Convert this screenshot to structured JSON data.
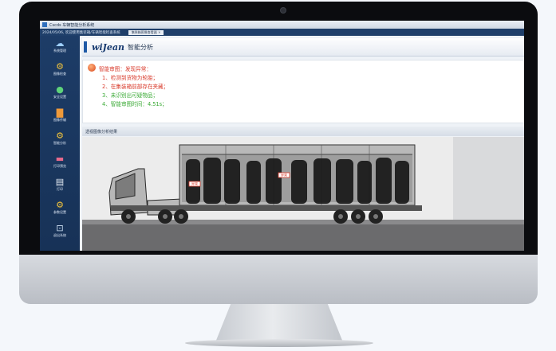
{
  "window": {
    "title": "Cscds 车辆智能分析系统",
    "info_text": "2024/05/06, 欢迎使用集装箱/车辆智能检查系统",
    "tab_label": "集装箱图像查看器"
  },
  "sidebar": {
    "items": [
      {
        "label": "系统管理",
        "icon": "cloud-icon"
      },
      {
        "label": "图像检查",
        "icon": "gear-icon"
      },
      {
        "label": "安全设置",
        "icon": "globe-icon"
      },
      {
        "label": "图像传输",
        "icon": "chart-icon"
      },
      {
        "label": "智能分析",
        "icon": "gear-icon"
      },
      {
        "label": "打印预览",
        "icon": "document-icon"
      },
      {
        "label": "打印",
        "icon": "printer-icon"
      },
      {
        "label": "参数设置",
        "icon": "gear-icon"
      },
      {
        "label": "退出系统",
        "icon": "exit-icon"
      }
    ]
  },
  "brand": {
    "logo": "wiJean",
    "module_title": "智能分析"
  },
  "alert": {
    "lines": [
      "智能审图：发现异常：",
      "1、检测到货物为轮胎；",
      "2、在集装箱前部存在夹藏；",
      "3、未识别出可疑物品；",
      "4、智能审图时间：4.51s；"
    ],
    "colors": {
      "warning": "#d93a2b",
      "ok": "#3aaa35"
    }
  },
  "image_panel": {
    "header": "透视图像分析结果",
    "markers": [
      "异常",
      "异常"
    ]
  }
}
